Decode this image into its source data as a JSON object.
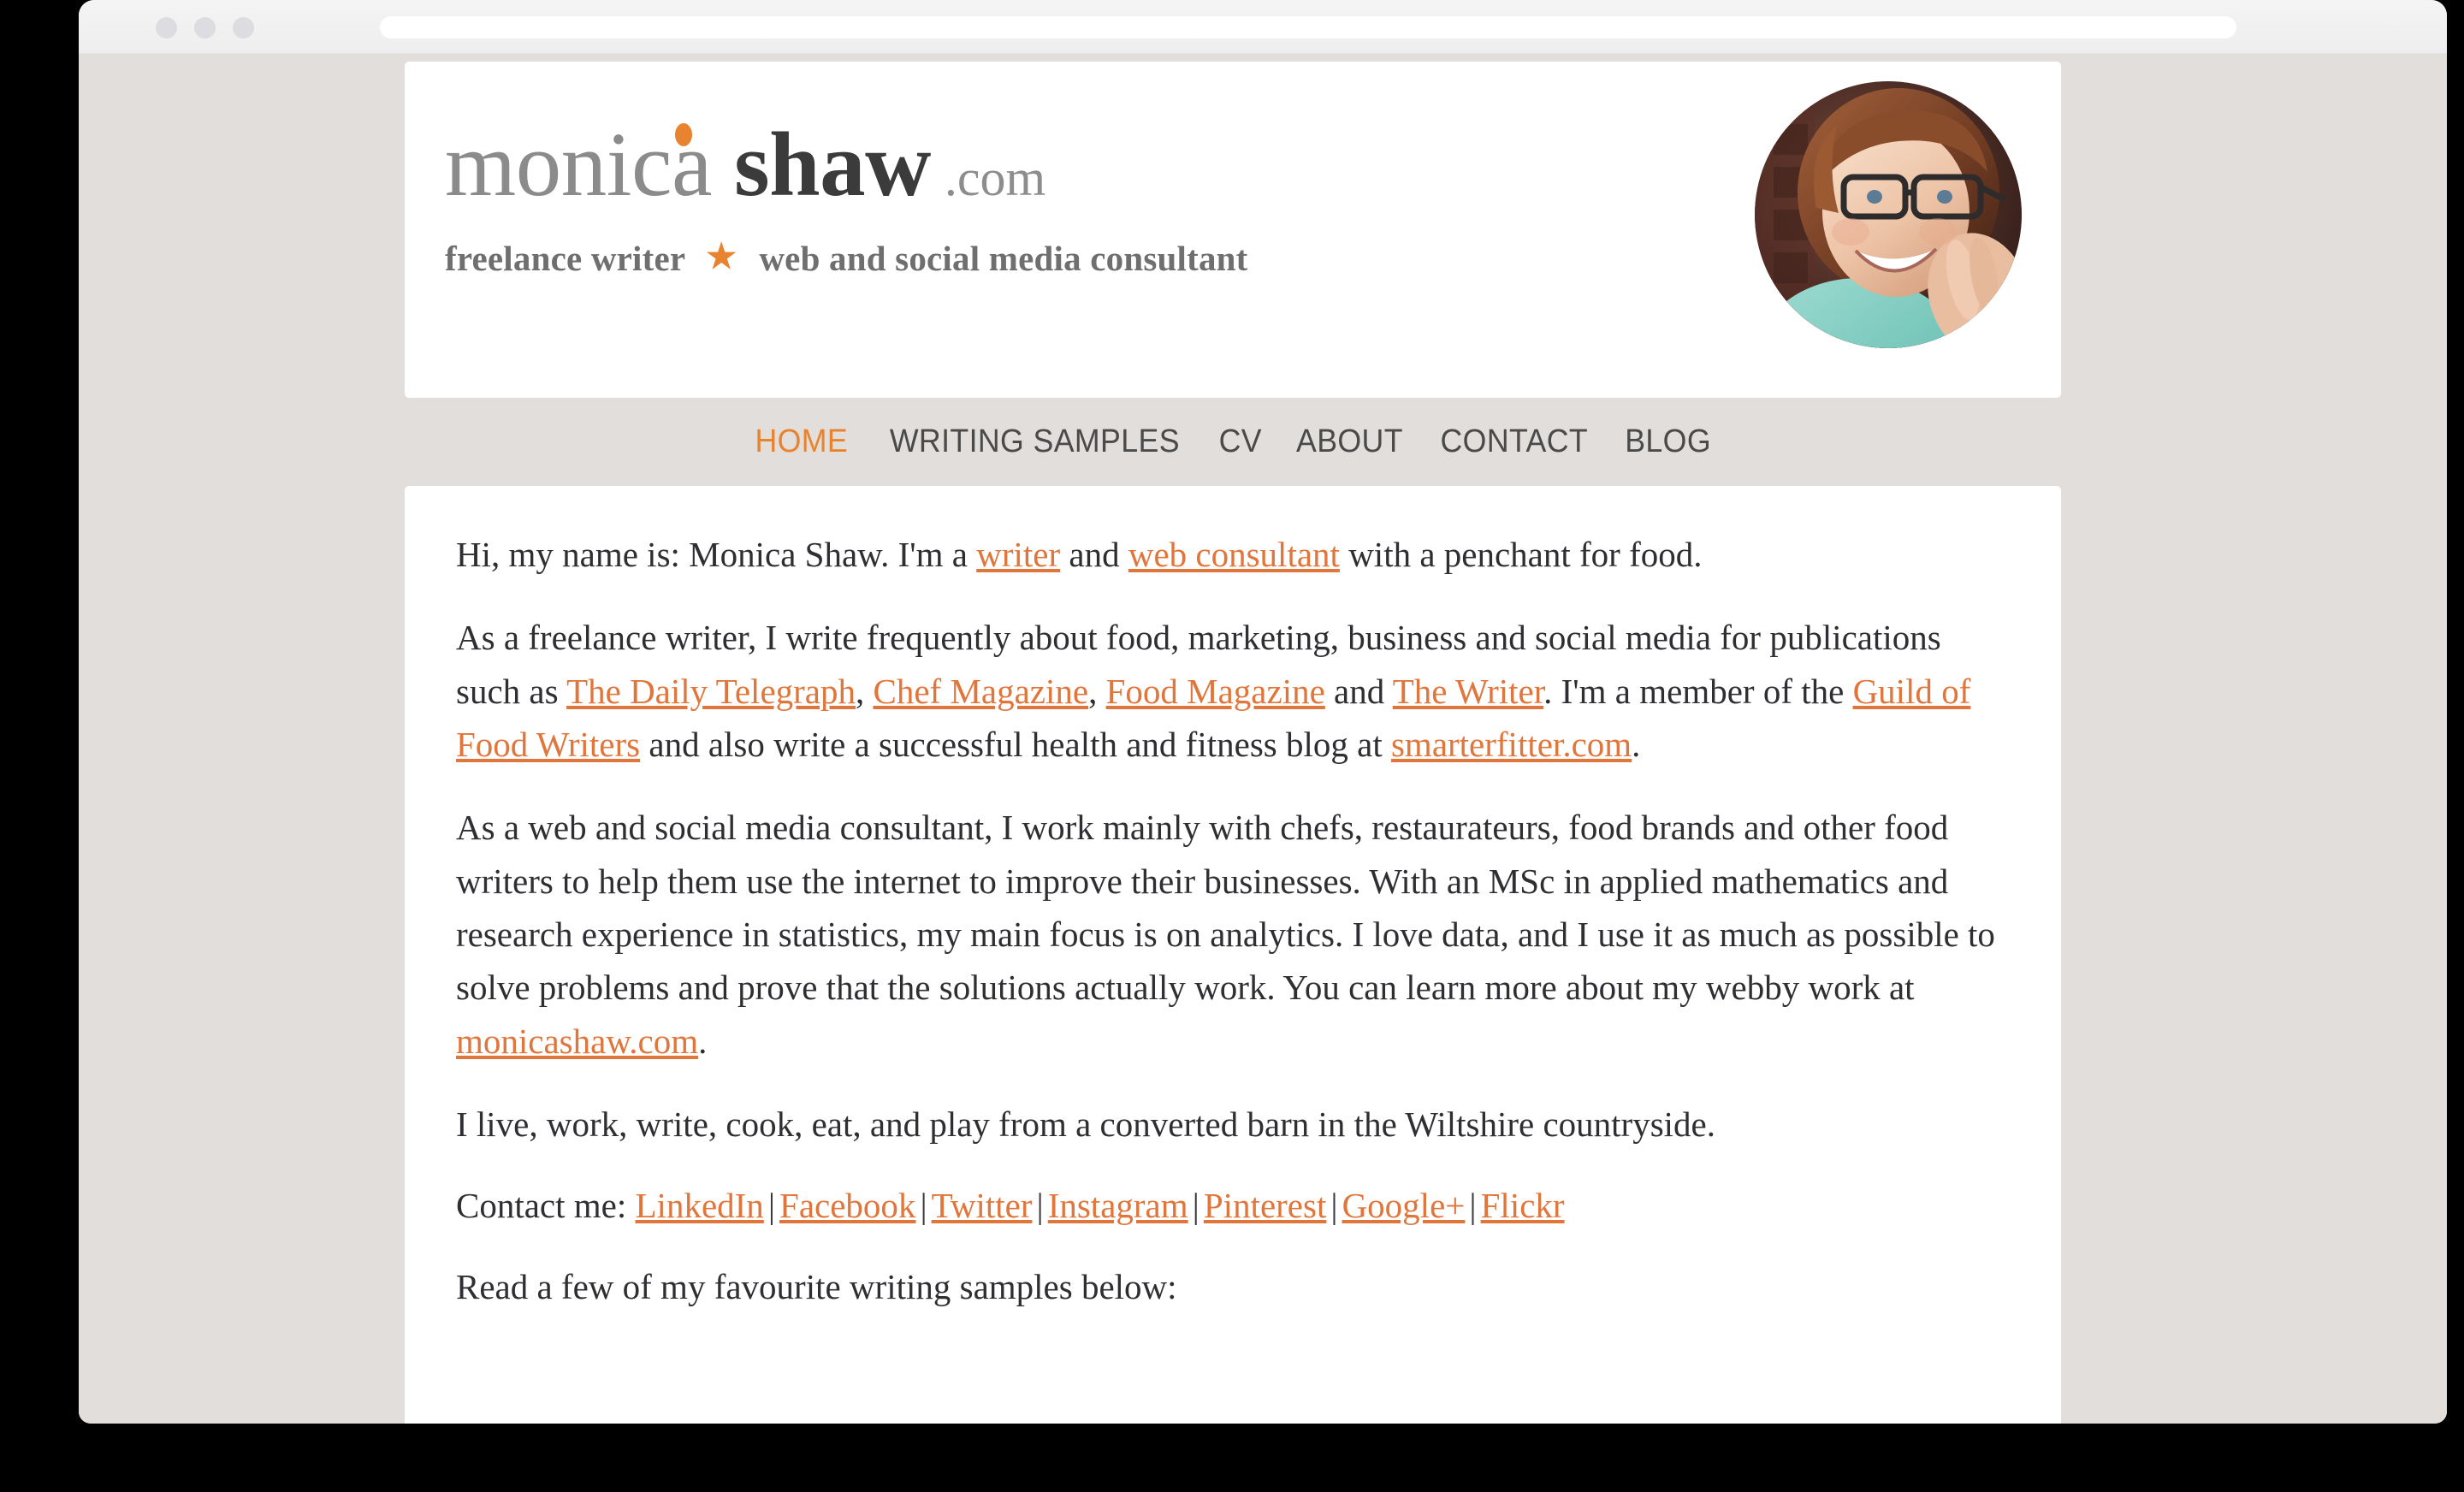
{
  "browser": {
    "traffic_lights": [
      "close",
      "minimize",
      "maximize"
    ],
    "address_bar_value": ""
  },
  "site": {
    "logo": {
      "part1": "monica",
      "part2": "shaw",
      "part3": ".com"
    },
    "tagline": {
      "left": "freelance writer",
      "star": "★",
      "right": "web and social media consultant"
    },
    "avatar_alt": "Monica Shaw headshot"
  },
  "nav": {
    "items": [
      {
        "label": "HOME",
        "active": true
      },
      {
        "label": "WRITING SAMPLES",
        "active": false
      },
      {
        "label": "CV",
        "active": false
      },
      {
        "label": "ABOUT",
        "active": false
      },
      {
        "label": "CONTACT",
        "active": false
      },
      {
        "label": "BLOG",
        "active": false
      }
    ]
  },
  "content": {
    "p1": {
      "t1": "Hi, my name is: Monica Shaw. I'm a ",
      "link1": "writer",
      "t2": " and ",
      "link2": "web consultant",
      "t3": " with a penchant for food."
    },
    "p2": {
      "t1": "As a freelance writer, I write frequently about food, marketing, business and social media for publications such as ",
      "link1": "The Daily Telegraph",
      "t2": ", ",
      "link2": "Chef Magazine",
      "t3": ", ",
      "link3": "Food Magazine",
      "t4": " and ",
      "link4": "The Writer",
      "t5": ". I'm a member of the ",
      "link5": "Guild of Food Writers",
      "t6": " and also write a successful health and fitness blog at ",
      "link6": "smarterfitter.com",
      "t7": "."
    },
    "p3": {
      "t1": "As a web and social media consultant, I work mainly with chefs, restaurateurs, food brands and other food writers to help them use the internet to improve their businesses. With an MSc in applied mathematics and research experience in statistics, my main focus is on analytics. I love data, and I use it as much as possible to solve problems and prove that the solutions actually work. You can learn more about my webby work at ",
      "link1": "monicashaw.com",
      "t2": "."
    },
    "p4": {
      "text": "I live, work, write, cook, eat, and play from a converted barn in the Wiltshire countryside."
    },
    "p5": {
      "label": "Contact me: ",
      "separator": "|",
      "links": [
        "LinkedIn",
        "Facebook",
        "Twitter",
        "Instagram",
        "Pinterest",
        "Google+",
        "Flickr"
      ]
    },
    "p6": {
      "text": "Read a few of my favourite writing samples below:"
    }
  },
  "colors": {
    "accent_orange": "#e8832f",
    "link_orange": "#e0763c",
    "page_background": "#e2dedb",
    "panel_background": "#ffffff",
    "body_text": "#2f2f33",
    "logo_gray": "#8b8b8b",
    "logo_dark": "#3b3b3b"
  }
}
